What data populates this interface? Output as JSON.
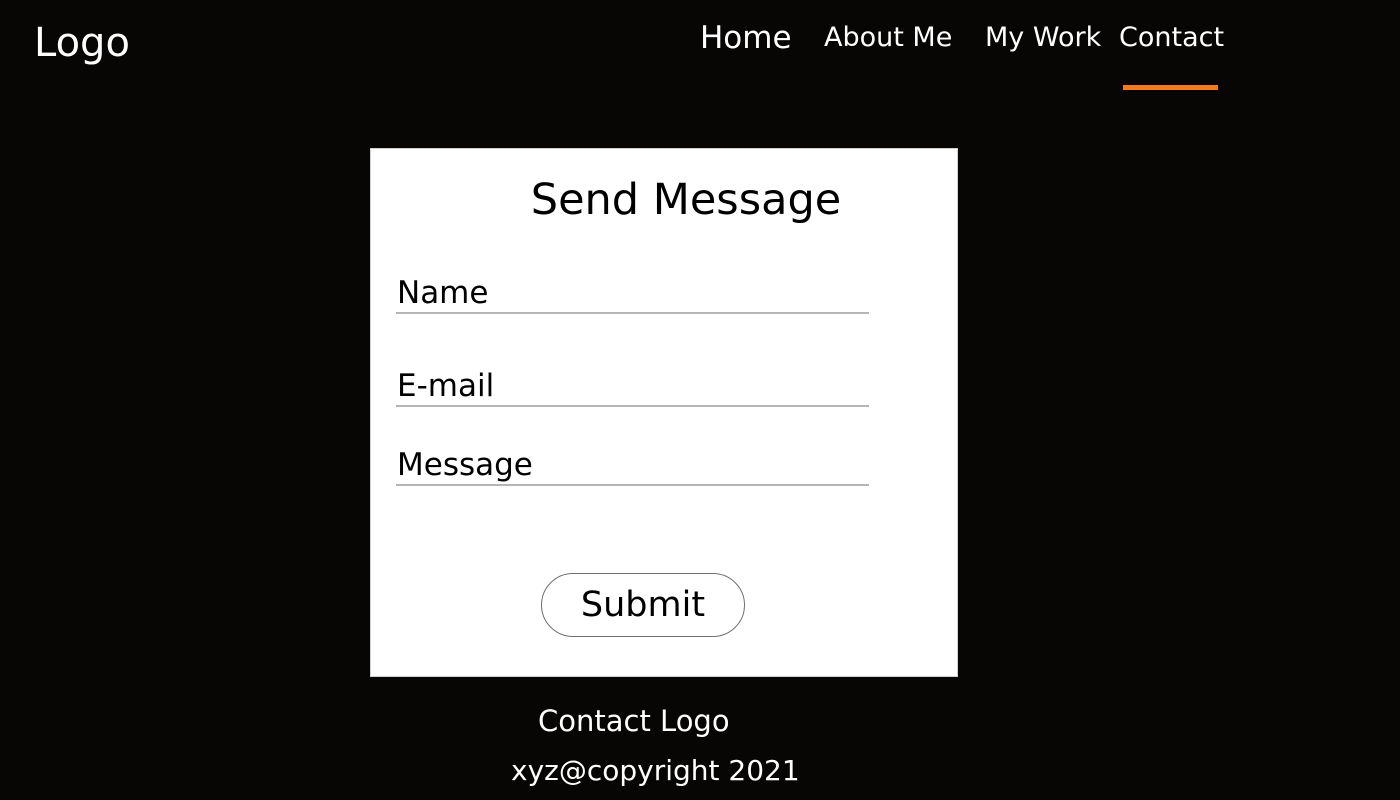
{
  "header": {
    "logo": "Logo",
    "nav": {
      "home": "Home",
      "about": "About Me",
      "work": "My Work",
      "contact": "Contact"
    },
    "active_nav": "Contact",
    "accent_color": "#f47a20"
  },
  "form": {
    "title": "Send Message",
    "name_placeholder": "Name",
    "email_placeholder": "E-mail",
    "message_placeholder": "Message",
    "submit_label": "Submit"
  },
  "footer": {
    "logo": "Contact Logo",
    "copyright": "xyz@copyright 2021"
  }
}
